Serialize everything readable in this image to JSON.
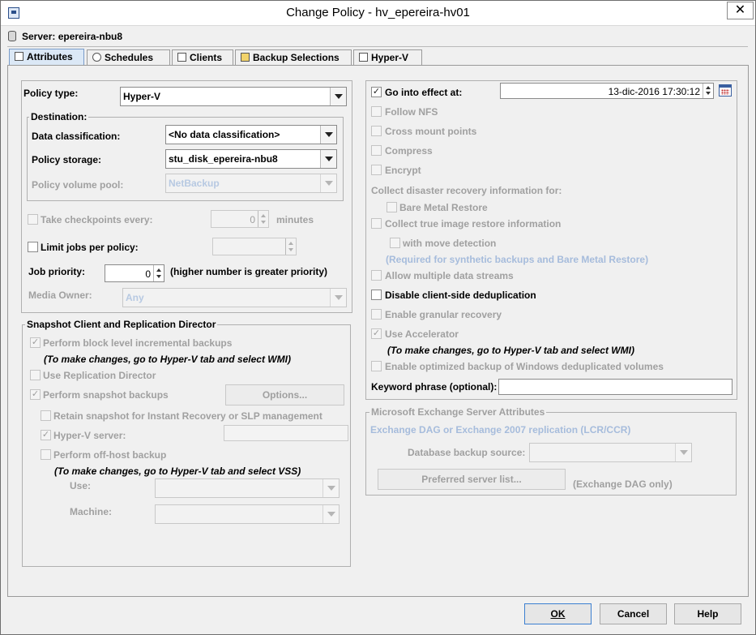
{
  "window": {
    "title": "Change Policy - hv_epereira-hv01",
    "close_glyph": "✕"
  },
  "server": {
    "label": "Server: epereira-nbu8"
  },
  "tabs": [
    {
      "label": "Attributes",
      "icon": "attributes-icon"
    },
    {
      "label": "Schedules",
      "icon": "schedules-icon"
    },
    {
      "label": "Clients",
      "icon": "clients-icon"
    },
    {
      "label": "Backup Selections",
      "icon": "backup-selections-icon"
    },
    {
      "label": "Hyper-V",
      "icon": "hyper-v-icon"
    }
  ],
  "left": {
    "policy_type_label": "Policy type:",
    "policy_type_value": "Hyper-V",
    "destination_legend": "Destination:",
    "data_classification_label": "Data classification:",
    "data_classification_value": "<No data classification>",
    "policy_storage_label": "Policy storage:",
    "policy_storage_value": "stu_disk_epereira-nbu8",
    "policy_volume_pool_label": "Policy volume pool:",
    "policy_volume_pool_value": "NetBackup",
    "take_checkpoints_label": "Take checkpoints every:",
    "take_checkpoints_value": "0",
    "minutes_label": "minutes",
    "limit_jobs_label": "Limit jobs per policy:",
    "limit_jobs_value": "",
    "job_priority_label": "Job priority:",
    "job_priority_value": "0",
    "job_priority_hint": "(higher number is greater priority)",
    "media_owner_label": "Media Owner:",
    "media_owner_value": "Any"
  },
  "snapshot": {
    "legend": "Snapshot Client and Replication Director",
    "block_level_label": "Perform block level incremental backups",
    "block_level_hint": "(To make changes, go to Hyper-V tab and select WMI)",
    "replication_director_label": "Use Replication Director",
    "snapshot_backups_label": "Perform snapshot backups",
    "options_button": "Options...",
    "retain_snapshot_label": "Retain snapshot for Instant Recovery or SLP management",
    "hyperv_server_label": "Hyper-V server:",
    "offhost_label": "Perform off-host backup",
    "offhost_hint": "(To make changes, go to Hyper-V tab and select VSS)",
    "use_label": "Use:",
    "machine_label": "Machine:"
  },
  "right": {
    "go_into_effect_label": "Go into effect at:",
    "go_into_effect_value": "13-dic-2016 17:30:12",
    "follow_nfs_label": "Follow NFS",
    "cross_mount_label": "Cross mount points",
    "compress_label": "Compress",
    "encrypt_label": "Encrypt",
    "collect_dr_label": "Collect disaster recovery information for:",
    "bmr_label": "Bare Metal Restore",
    "true_image_label": "Collect true image restore information",
    "move_detection_label": "with move detection",
    "required_hint": "(Required for synthetic backups and Bare Metal Restore)",
    "multiple_streams_label": "Allow multiple data streams",
    "disable_dedup_label": "Disable client-side deduplication",
    "granular_label": "Enable granular recovery",
    "accelerator_label": "Use Accelerator",
    "accelerator_hint": "(To make changes, go to Hyper-V tab and select WMI)",
    "optimized_label": "Enable optimized backup of Windows deduplicated volumes",
    "keyword_label": "Keyword phrase (optional):",
    "keyword_value": ""
  },
  "exchange": {
    "legend": "Microsoft Exchange Server Attributes",
    "dag_label": "Exchange DAG or Exchange 2007 replication (LCR/CCR)",
    "db_source_label": "Database backup source:",
    "preferred_button": "Preferred server list...",
    "dag_only_label": "(Exchange DAG only)"
  },
  "footer": {
    "ok": "OK",
    "cancel": "Cancel",
    "help": "Help"
  },
  "check_glyph": "✓"
}
